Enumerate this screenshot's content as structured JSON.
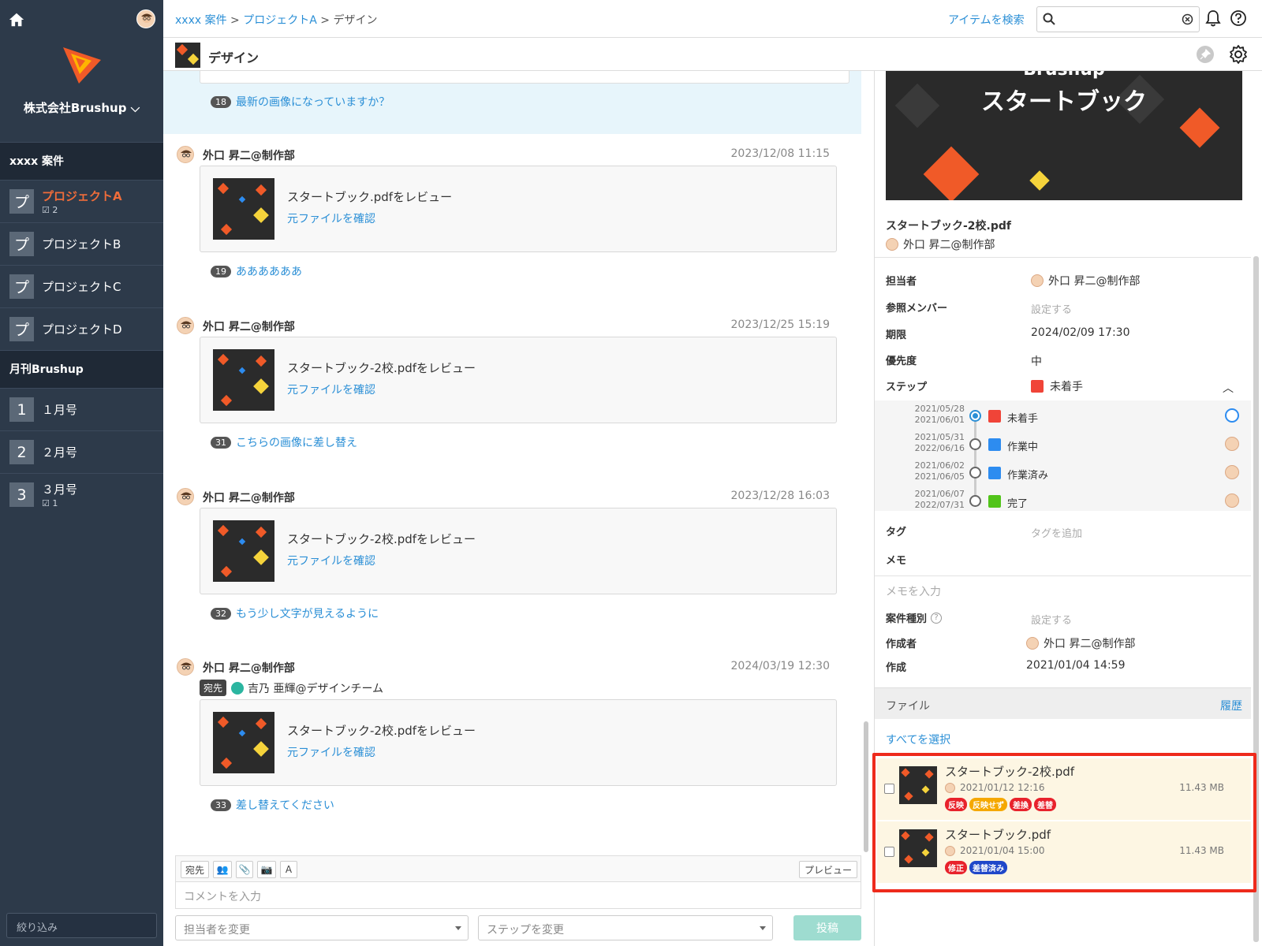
{
  "sidebar": {
    "company": "株式会社Brushup",
    "sections": [
      {
        "title": "xxxx 案件",
        "items": [
          {
            "badge": "プ",
            "label": "プロジェクトA",
            "sub": "2",
            "active": true
          },
          {
            "badge": "プ",
            "label": "プロジェクトB",
            "sub": ""
          },
          {
            "badge": "プ",
            "label": "プロジェクトC",
            "sub": ""
          },
          {
            "badge": "プ",
            "label": "プロジェクトD",
            "sub": ""
          }
        ]
      },
      {
        "title": "月刊Brushup",
        "items": [
          {
            "badge": "1",
            "label": "１月号",
            "sub": ""
          },
          {
            "badge": "2",
            "label": "２月号",
            "sub": ""
          },
          {
            "badge": "3",
            "label": "３月号",
            "sub": "1"
          }
        ]
      }
    ],
    "filter_placeholder": "絞り込み"
  },
  "header": {
    "breadcrumb": {
      "a": "xxxx 案件",
      "sep1": " > ",
      "b": "プロジェクトA",
      "sep2": " > ",
      "current": "デザイン"
    },
    "search_link": "アイテムを検索",
    "search_value": ""
  },
  "subheader": {
    "title": "デザイン"
  },
  "feed": {
    "highlight_comment": {
      "num": "18",
      "text": "最新の画像になっていますか？"
    },
    "posts": [
      {
        "author": "外口 昇二@制作部",
        "time": "2023/12/08 11:15",
        "text": "スタートブック.pdfをレビュー",
        "link": "元ファイルを確認",
        "num": "19",
        "comment": "ああああああ"
      },
      {
        "author": "外口 昇二@制作部",
        "time": "2023/12/25 15:19",
        "text": "スタートブック-2校.pdfをレビュー",
        "link": "元ファイルを確認",
        "num": "31",
        "comment": "こちらの画像に差し替え"
      },
      {
        "author": "外口 昇二@制作部",
        "time": "2023/12/28 16:03",
        "text": "スタートブック-2校.pdfをレビュー",
        "link": "元ファイルを確認",
        "num": "32",
        "comment": "もう少し文字が見えるように"
      },
      {
        "author": "外口 昇二@制作部",
        "time": "2024/03/19 12:30",
        "to_label": "宛先",
        "to": "吉乃 亜輝@デザインチーム",
        "text": "スタートブック-2校.pdfをレビュー",
        "link": "元ファイルを確認",
        "num": "33",
        "comment": "差し替えてください"
      }
    ]
  },
  "composer": {
    "to_btn": "宛先",
    "font_btn": "A",
    "preview_btn": "プレビュー",
    "placeholder": "コメントを入力",
    "assignee_select": "担当者を変更",
    "step_select": "ステップを変更",
    "post_btn": "投稿"
  },
  "detail": {
    "preview_brand": "Brushup",
    "preview_title": "スタートブック",
    "file_name": "スタートブック-2校.pdf",
    "owner": "外口 昇二@制作部",
    "props": {
      "assignee_l": "担当者",
      "assignee_v": "外口 昇二@制作部",
      "members_l": "参照メンバー",
      "members_v": "設定する",
      "due_l": "期限",
      "due_v": "2024/02/09 17:30",
      "priority_l": "優先度",
      "priority_v": "中",
      "step_l": "ステップ",
      "step_v": "未着手",
      "tag_l": "タグ",
      "tag_v": "タグを追加",
      "memo_l": "メモ",
      "memo_placeholder": "メモを入力",
      "kind_l": "案件種別",
      "kind_v": "設定する",
      "creator_l": "作成者",
      "creator_v": "外口 昇二@制作部",
      "created_l": "作成",
      "created_v": "2021/01/04 14:59"
    },
    "steps": [
      {
        "d1": "2021/05/28",
        "d2": "2021/06/01",
        "name": "未着手",
        "color": "#f04438"
      },
      {
        "d1": "2021/05/31",
        "d2": "2022/06/16",
        "name": "作業中",
        "color": "#2d8cf0"
      },
      {
        "d1": "2021/06/02",
        "d2": "2021/06/05",
        "name": "作業済み",
        "color": "#2d8cf0"
      },
      {
        "d1": "2021/06/07",
        "d2": "2022/07/31",
        "name": "完了",
        "color": "#52c41a"
      }
    ],
    "files_title": "ファイル",
    "history": "履歴",
    "select_all": "すべてを選択",
    "files": [
      {
        "name": "スタートブック-2校.pdf",
        "date": "2021/01/12 12:16",
        "size": "11.43 MB",
        "tags": [
          {
            "t": "反映",
            "c": "#e8222c"
          },
          {
            "t": "反映せず",
            "c": "#f5a800"
          },
          {
            "t": "差換",
            "c": "#e8222c"
          },
          {
            "t": "差替",
            "c": "#e8222c"
          }
        ]
      },
      {
        "name": "スタートブック.pdf",
        "date": "2021/01/04 15:00",
        "size": "11.43 MB",
        "tags": [
          {
            "t": "修正",
            "c": "#e8222c"
          },
          {
            "t": "差替済み",
            "c": "#1f47c9"
          }
        ]
      }
    ]
  }
}
